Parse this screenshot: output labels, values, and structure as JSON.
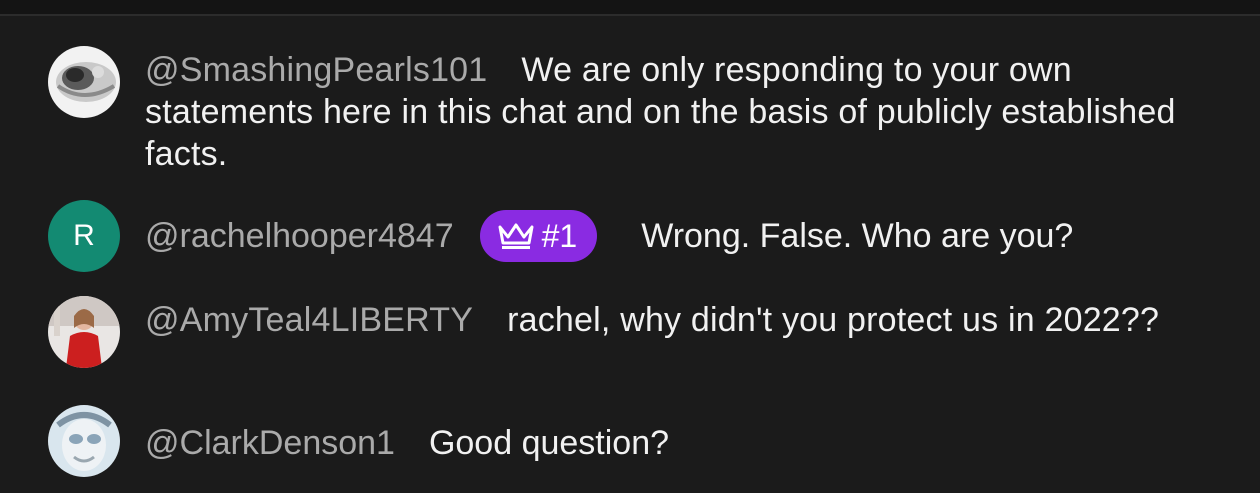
{
  "chat": {
    "messages": [
      {
        "author": "@SmashingPearls101",
        "text": "We are only responding to your own statements here in this chat and on the basis of publicly established facts.",
        "avatar_icon": "user-photo-avatar"
      },
      {
        "author": "@rachelhooper4847",
        "avatar_letter": "R",
        "avatar_color": "#138a72",
        "badge": {
          "icon": "crown-icon",
          "label": "#1",
          "color": "#8a2be2"
        },
        "text": "Wrong. False. Who are you?"
      },
      {
        "author": "@AmyTeal4LIBERTY",
        "text": "rachel, why didn't you protect us in 2022??",
        "avatar_icon": "user-photo-avatar"
      },
      {
        "author": "@ClarkDenson1",
        "text": "Good question?",
        "avatar_icon": "user-photo-avatar"
      }
    ]
  }
}
